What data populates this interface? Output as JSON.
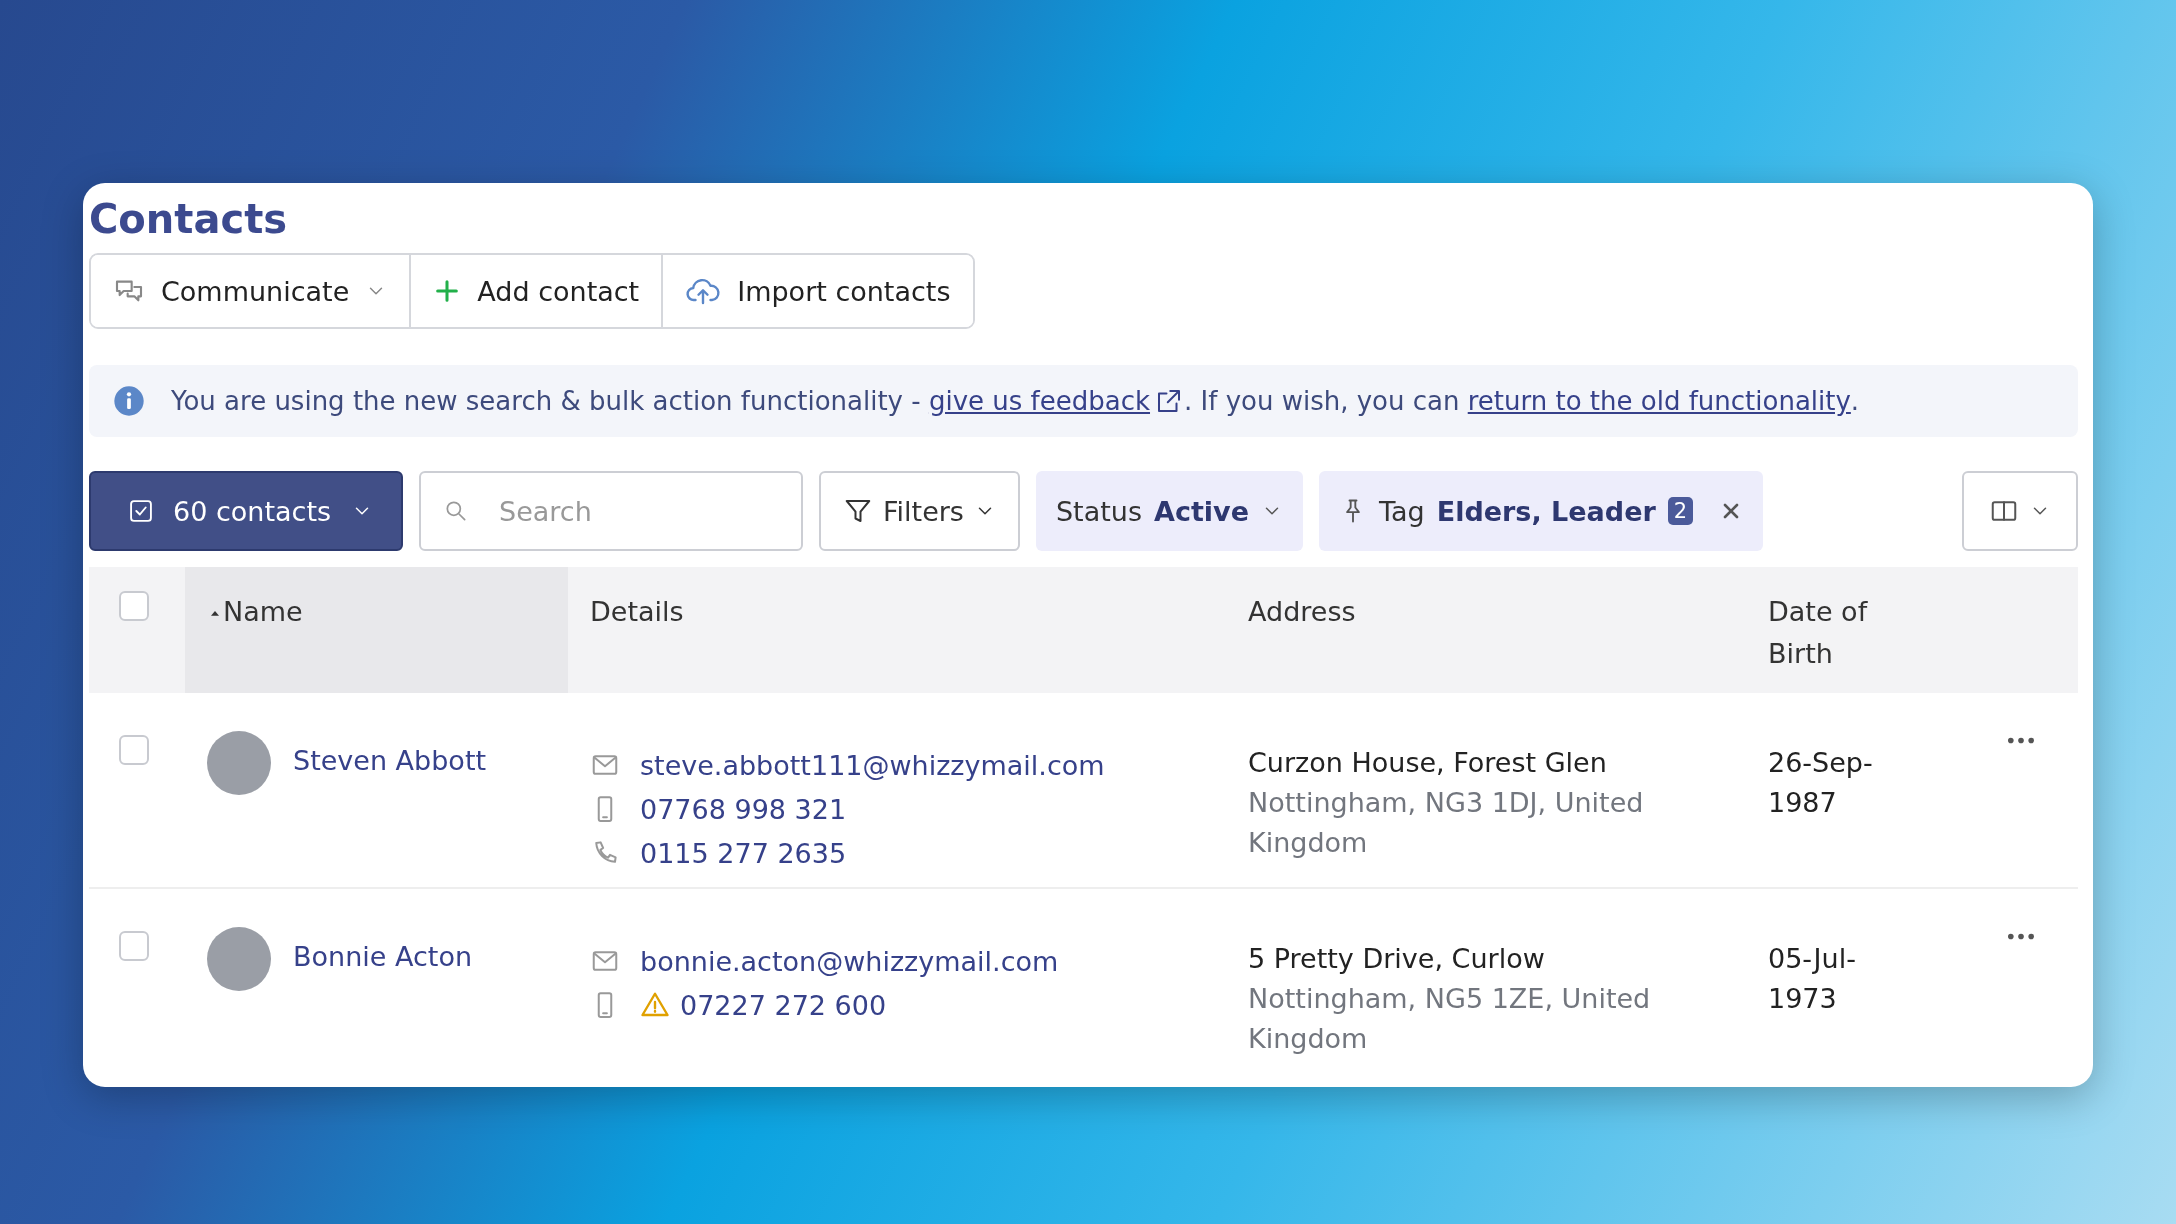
{
  "title": "Contacts",
  "toolbar": [
    {
      "kind": "communicate",
      "label": "Communicate"
    },
    {
      "kind": "add",
      "label": "Add contact"
    },
    {
      "kind": "import",
      "label": "Import contacts"
    }
  ],
  "notice": {
    "text_before": "You are using the new search & bulk action functionality - ",
    "feedback_link": "give us feedback",
    "text_middle": ". If you wish, you can ",
    "old_link": "return to the old functionality",
    "text_after": "."
  },
  "filter_bar": {
    "selection": "60 contacts",
    "search_placeholder": "Search",
    "filters": "Filters",
    "status": {
      "label": "Status",
      "value": "Active"
    },
    "tag": {
      "label": "Tag",
      "value": "Elders, Leader",
      "count": "2"
    }
  },
  "table": {
    "header_checked": false,
    "columns": [
      {
        "label": "Name",
        "sorted": true
      },
      {
        "label": "Details",
        "sorted": false
      },
      {
        "label": "Address",
        "sorted": false
      },
      {
        "label": "Date of Birth",
        "sorted": false
      }
    ],
    "rows": [
      {
        "checked": false,
        "name": "Steven Abbott",
        "details": [
          {
            "kind": "email",
            "value": "steve.abbott111@whizzymail.com",
            "warning": false
          },
          {
            "kind": "mobile",
            "value": "07768 998 321",
            "warning": false
          },
          {
            "kind": "phone",
            "value": "0115 277 2635",
            "warning": false
          }
        ],
        "address_line1": "Curzon House, Forest Glen",
        "address_line2": "Nottingham, NG3 1DJ, United Kingdom",
        "dob": "26-Sep-1987"
      },
      {
        "checked": false,
        "name": "Bonnie Acton",
        "details": [
          {
            "kind": "email",
            "value": "bonnie.acton@whizzymail.com",
            "warning": false
          },
          {
            "kind": "mobile",
            "value": "07227 272 600",
            "warning": true
          }
        ],
        "address_line1": "5 Pretty Drive, Curlow",
        "address_line2": "Nottingham, NG5 1ZE, United Kingdom",
        "dob": "05-Jul-1973"
      }
    ]
  }
}
